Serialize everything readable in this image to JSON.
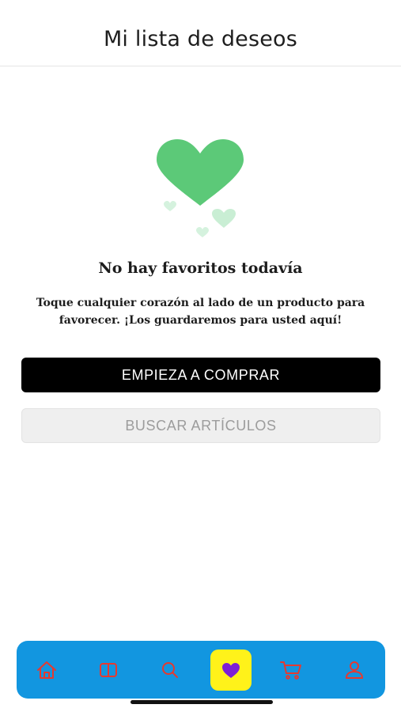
{
  "header": {
    "title": "Mi lista de deseos"
  },
  "empty_state": {
    "title": "No hay favoritos todavía",
    "description": "Toque cualquier corazón al lado de un producto para favorecer. ¡Los guardaremos para usted aquí!"
  },
  "actions": {
    "primary_label": "EMPIEZA A COMPRAR",
    "secondary_label": "BUSCAR ARTÍCULOS"
  },
  "tabbar": {
    "items": [
      {
        "icon": "home-icon",
        "active": false
      },
      {
        "icon": "catalog-icon",
        "active": false
      },
      {
        "icon": "search-icon",
        "active": false
      },
      {
        "icon": "heart-icon",
        "active": true
      },
      {
        "icon": "cart-icon",
        "active": false
      },
      {
        "icon": "profile-icon",
        "active": false
      }
    ]
  },
  "colors": {
    "heart_green": "#5cc978",
    "tabbar_bg": "#1296e0",
    "tab_icon": "#e6392f",
    "active_tab_bg": "#fff21a",
    "active_icon": "#7d1fd6"
  }
}
